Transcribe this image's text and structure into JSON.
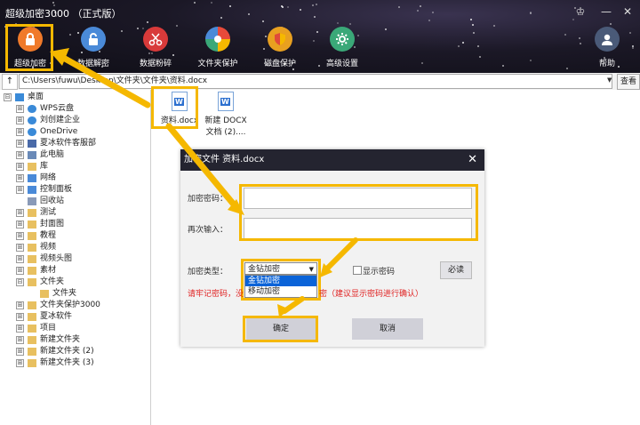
{
  "app": {
    "title": "超级加密3000 （正式版）"
  },
  "window_controls": {
    "skin": "♔",
    "minimize": "—",
    "close": "✕"
  },
  "toolbar": [
    {
      "label": "超级加密",
      "icon": "lock-icon",
      "color": "#f07a2a"
    },
    {
      "label": "数据解密",
      "icon": "unlock-icon",
      "color": "#4a8ad8"
    },
    {
      "label": "数据粉碎",
      "icon": "scissors-icon",
      "color": "#d83a3a"
    },
    {
      "label": "文件夹保护",
      "icon": "shield-color-icon",
      "color": "#e8a020"
    },
    {
      "label": "磁盘保护",
      "icon": "shield-icon",
      "color": "#e04a3a"
    },
    {
      "label": "高级设置",
      "icon": "gear-icon",
      "color": "#3aa878"
    },
    {
      "label": "帮助",
      "icon": "user-icon",
      "color": "#4a5a78"
    }
  ],
  "pathbar": {
    "up": "↑",
    "path": "C:\\Users\\fuwu\\Desktop\\文件夹\\文件夹\\资料.docx",
    "view": "查看"
  },
  "tree": [
    {
      "label": "桌面",
      "level": 0,
      "expander": "⊟",
      "icon": "desktop-icon"
    },
    {
      "label": "WPS云盘",
      "level": 1,
      "expander": "⊞",
      "icon": "cloud-icon"
    },
    {
      "label": "刘创建企业",
      "level": 1,
      "expander": "⊞",
      "icon": "cloud-icon"
    },
    {
      "label": "OneDrive",
      "level": 1,
      "expander": "⊞",
      "icon": "cloud-icon"
    },
    {
      "label": "夏冰软件客服部",
      "level": 1,
      "expander": "⊞",
      "icon": "user-icon"
    },
    {
      "label": "此电脑",
      "level": 1,
      "expander": "⊞",
      "icon": "computer-icon"
    },
    {
      "label": "库",
      "level": 1,
      "expander": "⊞",
      "icon": "folder-icon"
    },
    {
      "label": "网络",
      "level": 1,
      "expander": "⊞",
      "icon": "network-icon"
    },
    {
      "label": "控制面板",
      "level": 1,
      "expander": "⊞",
      "icon": "control-panel-icon"
    },
    {
      "label": "回收站",
      "level": 1,
      "expander": "",
      "icon": "recycle-icon"
    },
    {
      "label": "测试",
      "level": 1,
      "expander": "⊞",
      "icon": "folder-icon"
    },
    {
      "label": "封面图",
      "level": 1,
      "expander": "⊞",
      "icon": "folder-icon"
    },
    {
      "label": "教程",
      "level": 1,
      "expander": "⊞",
      "icon": "folder-icon"
    },
    {
      "label": "视频",
      "level": 1,
      "expander": "⊞",
      "icon": "folder-icon"
    },
    {
      "label": "视频头图",
      "level": 1,
      "expander": "⊞",
      "icon": "folder-icon"
    },
    {
      "label": "素材",
      "level": 1,
      "expander": "⊞",
      "icon": "folder-icon"
    },
    {
      "label": "文件夹",
      "level": 1,
      "expander": "⊟",
      "icon": "folder-icon"
    },
    {
      "label": "文件夹",
      "level": 2,
      "expander": "",
      "icon": "folder-icon"
    },
    {
      "label": "文件夹保护3000",
      "level": 1,
      "expander": "⊞",
      "icon": "folder-icon"
    },
    {
      "label": "夏冰软件",
      "level": 1,
      "expander": "⊞",
      "icon": "folder-icon"
    },
    {
      "label": "项目",
      "level": 1,
      "expander": "⊞",
      "icon": "folder-icon"
    },
    {
      "label": "新建文件夹",
      "level": 1,
      "expander": "⊞",
      "icon": "folder-icon"
    },
    {
      "label": "新建文件夹 (2)",
      "level": 1,
      "expander": "⊞",
      "icon": "folder-icon"
    },
    {
      "label": "新建文件夹 (3)",
      "level": 1,
      "expander": "⊞",
      "icon": "folder-icon"
    }
  ],
  "files": [
    {
      "name": "资料.docx",
      "name2": ""
    },
    {
      "name": "新建 DOCX",
      "name2": "文档 (2)...."
    }
  ],
  "dialog": {
    "title": "加密文件 资料.docx",
    "close": "✕",
    "password_label": "加密密码：",
    "confirm_label": "再次输入：",
    "type_label": "加密类型：",
    "type_selected": "金钻加密",
    "type_options": [
      "金钻加密",
      "移动加密"
    ],
    "show_password": "显示密码",
    "must_read": "必读",
    "warning_left": "请牢记密码，没",
    "warning_right": "密（建议显示密码进行确认）",
    "ok": "确定",
    "cancel": "取消"
  },
  "colors": {
    "highlight": "#f5b800",
    "selected_option": "#0a63d8",
    "warning": "#e02020",
    "title_bar": "#242430"
  }
}
